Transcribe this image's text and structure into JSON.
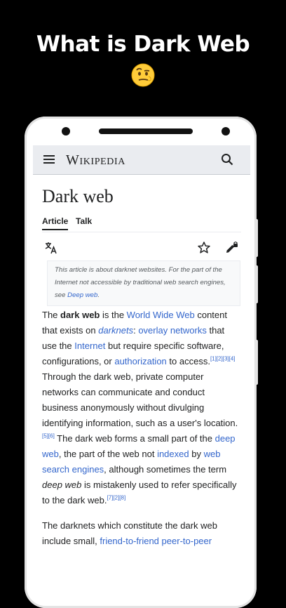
{
  "promo": {
    "title": "What is Dark Web"
  },
  "icons": {
    "emoji": "raised-eyebrow-emoji",
    "menu": "hamburger-menu-icon",
    "search": "search-icon",
    "language": "translate-language-icon",
    "watch": "star-icon",
    "edit": "edit-locked-icon"
  },
  "colors": {
    "background": "#000000",
    "link": "#3366cc",
    "text": "#202122",
    "topbar": "#eaecf0"
  },
  "app": {
    "logo": "Wikipedia",
    "page_title": "Dark web",
    "tabs": [
      {
        "label": "Article",
        "active": true
      },
      {
        "label": "Talk",
        "active": false
      }
    ]
  },
  "hatnote": {
    "text1": "This article is about darknet websites. For the part of the Internet not accessible by traditional web search engines, see ",
    "link": "Deep web",
    "text2": "."
  },
  "article": {
    "p1": {
      "t1": "The ",
      "bold": "dark web",
      "t2": " is the ",
      "l_www": "World Wide Web",
      "t3": " content that exists on ",
      "l_darknets": "darknets",
      "t4": ": ",
      "l_overlay": "overlay networks",
      "t5": " that use the ",
      "l_internet": "Internet",
      "t6": " but require specific software, configurations, or ",
      "l_auth": "authorization",
      "t7": " to access.",
      "cite1": "[1][2][3][4]",
      "t8": " Through the dark web, private computer networks can communicate and conduct business anonymously without divulging identifying information, such as a user's location.",
      "cite2": "[5][6]",
      "t9": " The dark web forms a small part of the ",
      "l_deep": "deep web",
      "t10": ", the part of the web not ",
      "l_indexed": "indexed",
      "t11": " by ",
      "l_wse": "web search engines",
      "t12": ", although sometimes the term ",
      "italic": "deep web",
      "t13": " is mistakenly used to refer specifically to the dark web.",
      "cite3": "[7][2][8]"
    },
    "p2": {
      "t1": "The darknets which constitute the dark web include small, ",
      "l_f2f": "friend-to-friend",
      "t2": " ",
      "l_p2p": "peer-to-peer"
    }
  }
}
